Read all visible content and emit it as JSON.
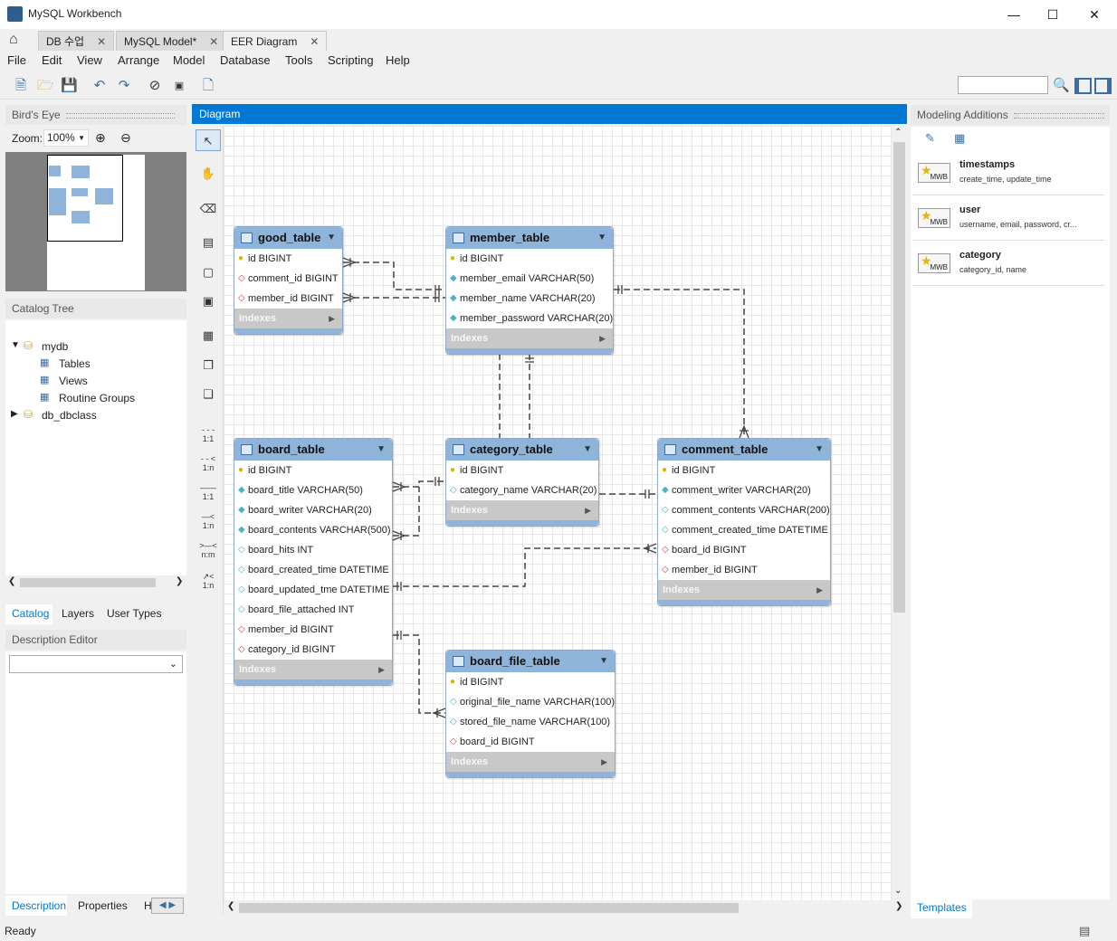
{
  "window": {
    "title": "MySQL Workbench"
  },
  "tabs": [
    {
      "label": "DB 수업"
    },
    {
      "label": "MySQL Model*"
    },
    {
      "label": "EER Diagram"
    }
  ],
  "menu": [
    "File",
    "Edit",
    "View",
    "Arrange",
    "Model",
    "Database",
    "Tools",
    "Scripting",
    "Help"
  ],
  "search": {
    "placeholder": ""
  },
  "left": {
    "birds_eye": "Bird's Eye",
    "zoom_label": "Zoom:",
    "zoom_value": "100%",
    "catalog_tree": "Catalog Tree",
    "tree": {
      "mydb": "mydb",
      "tables": "Tables",
      "views": "Views",
      "routines": "Routine Groups",
      "db2": "db_dbclass"
    },
    "tabs": [
      "Catalog",
      "Layers",
      "User Types"
    ],
    "desc_editor": "Description Editor",
    "bottom_tabs": [
      "Description",
      "Properties",
      "H"
    ]
  },
  "diagram": {
    "title": "Diagram"
  },
  "tables": {
    "good": {
      "name": "good_table",
      "cols": [
        "id BIGINT",
        "comment_id BIGINT",
        "member_id BIGINT"
      ],
      "indexes": "Indexes"
    },
    "member": {
      "name": "member_table",
      "cols": [
        "id BIGINT",
        "member_email VARCHAR(50)",
        "member_name VARCHAR(20)",
        "member_password VARCHAR(20)"
      ],
      "indexes": "Indexes"
    },
    "board": {
      "name": "board_table",
      "cols": [
        "id BIGINT",
        "board_title VARCHAR(50)",
        "board_writer VARCHAR(20)",
        "board_contents VARCHAR(500)",
        "board_hits INT",
        "board_created_time DATETIME",
        "board_updated_tme DATETIME",
        "board_file_attached INT",
        "member_id BIGINT",
        "category_id BIGINT"
      ],
      "indexes": "Indexes"
    },
    "category": {
      "name": "category_table",
      "cols": [
        "id BIGINT",
        "category_name VARCHAR(20)"
      ],
      "indexes": "Indexes"
    },
    "comment": {
      "name": "comment_table",
      "cols": [
        "id BIGINT",
        "comment_writer VARCHAR(20)",
        "comment_contents VARCHAR(200)",
        "comment_created_time DATETIME",
        "board_id BIGINT",
        "member_id BIGINT"
      ],
      "indexes": "Indexes"
    },
    "boardfile": {
      "name": "board_file_table",
      "cols": [
        "id BIGINT",
        "original_file_name VARCHAR(100)",
        "stored_file_name VARCHAR(100)",
        "board_id BIGINT"
      ],
      "indexes": "Indexes"
    }
  },
  "right": {
    "title": "Modeling Additions",
    "items": [
      {
        "name": "timestamps",
        "desc": "create_time, update_time"
      },
      {
        "name": "user",
        "desc": "username, email, password, cr..."
      },
      {
        "name": "category",
        "desc": "category_id, name"
      }
    ],
    "badge": "MWB",
    "tab": "Templates"
  },
  "status": {
    "text": "Ready"
  }
}
